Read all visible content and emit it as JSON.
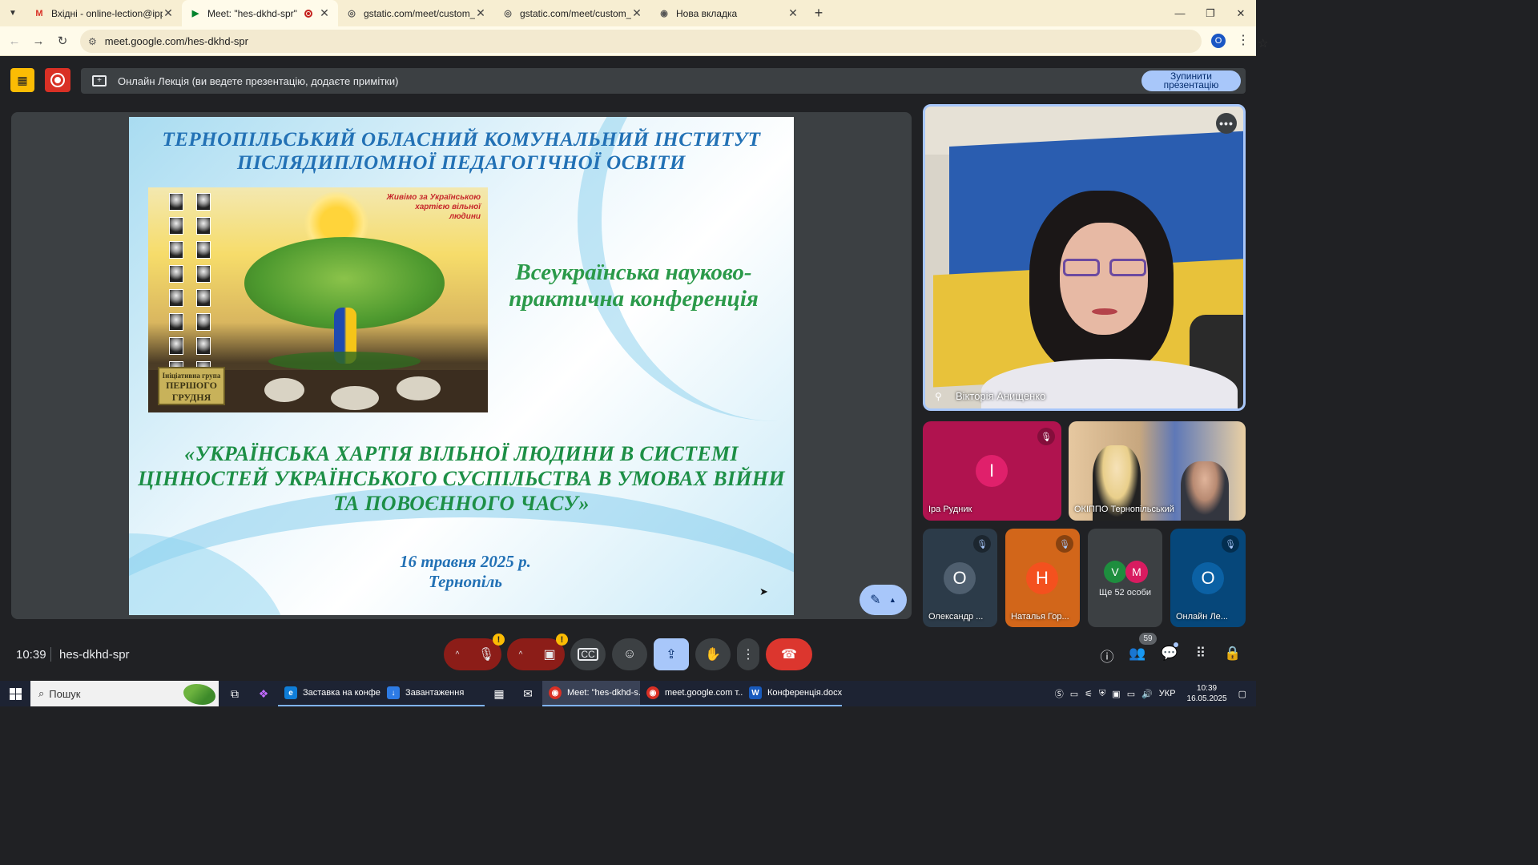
{
  "browser": {
    "tabs": [
      {
        "title": "Вхідні - online-lection@ippo.e",
        "icon": "gmail-icon",
        "active": false
      },
      {
        "title": "Meet: \"hes-dkhd-spr\"",
        "icon": "meet-icon",
        "active": true,
        "recording": true
      },
      {
        "title": "gstatic.com/meet/custom_keep",
        "icon": "globe-icon",
        "active": false
      },
      {
        "title": "gstatic.com/meet/custom_keep",
        "icon": "globe-icon",
        "active": false
      },
      {
        "title": "Нова вкладка",
        "icon": "chrome-icon",
        "active": false
      }
    ],
    "url": "meet.google.com/hes-dkhd-spr",
    "profile_initial": "O"
  },
  "presentation_banner": {
    "text": "Онлайн Лекція (ви ведете презентацію, додаєте примітки)",
    "stop_label": "Зупинити презентацію"
  },
  "slide": {
    "title": "ТЕРНОПІЛЬСЬКИЙ ОБЛАСНИЙ КОМУНАЛЬНИЙ ІНСТИТУТ ПІСЛЯДИПЛОМНОЇ ПЕДАГОГІЧНОЇ ОСВІТИ",
    "image_caption": "Живімо за Українською хартією вільної людини",
    "image_book_small": "Ініціативна група",
    "image_book_big": "ПЕРШОГО ГРУДНЯ",
    "conference": "Всеукраїнська науково-практична конференція",
    "theme": "«УКРАЇНСЬКА ХАРТІЯ ВІЛЬНОЇ ЛЮДИНИ В СИСТЕМІ ЦІННОСТЕЙ УКРАЇНСЬКОГО СУСПІЛЬСТВА В УМОВАХ ВІЙНИ ТА ПОВОЄННОГО ЧАСУ»",
    "date": "16 травня 2025 р.",
    "city": "Тернопіль"
  },
  "participants": {
    "speaker": {
      "name": "Вікторія Анищенко"
    },
    "tiles": [
      {
        "name": "Іра Рудник",
        "initial": "І",
        "color": "#e0206b",
        "bg": "#b0134f",
        "muted": true
      },
      {
        "name": "ОКІППО Тернопільський",
        "muted": false
      },
      {
        "name": "Олександр ...",
        "initial": "О",
        "color": "#4f5f6f",
        "bg": "#2c3b49",
        "muted": true
      },
      {
        "name": "Наталья Гор...",
        "initial": "Н",
        "color": "#f4511e",
        "bg": "#d2661a",
        "muted": true
      },
      {
        "more_label": "Ще 52 особи",
        "mini": [
          {
            "initial": "V",
            "color": "#1e8e3e"
          },
          {
            "initial": "M",
            "color": "#d81b60"
          }
        ]
      },
      {
        "name": "Онлайн Ле...",
        "initial": "О",
        "color": "#0b61a4",
        "bg": "#06477a",
        "muted": true
      }
    ]
  },
  "bottom_bar": {
    "time": "10:39",
    "meeting_code": "hes-dkhd-spr",
    "people_count": "59"
  },
  "taskbar": {
    "search_placeholder": "Пошук",
    "apps": [
      {
        "label": "Заставка на конфе...",
        "icon": "edge-icon",
        "color": "#0f7dd8",
        "active": false
      },
      {
        "label": "Завантаження",
        "icon": "download-icon",
        "color": "#2d7be5",
        "active": false
      },
      {
        "label": "Meet: \"hes-dkhd-s...",
        "icon": "chrome-icon",
        "color": "#d93025",
        "active": true
      },
      {
        "label": "meet.google.com т...",
        "icon": "chrome-icon",
        "color": "#d93025",
        "active": false
      },
      {
        "label": "Конференція.docx...",
        "icon": "word-icon",
        "color": "#185abd",
        "active": false
      }
    ],
    "lang": "УКР",
    "clock_time": "10:39",
    "clock_date": "16.05.2025"
  }
}
